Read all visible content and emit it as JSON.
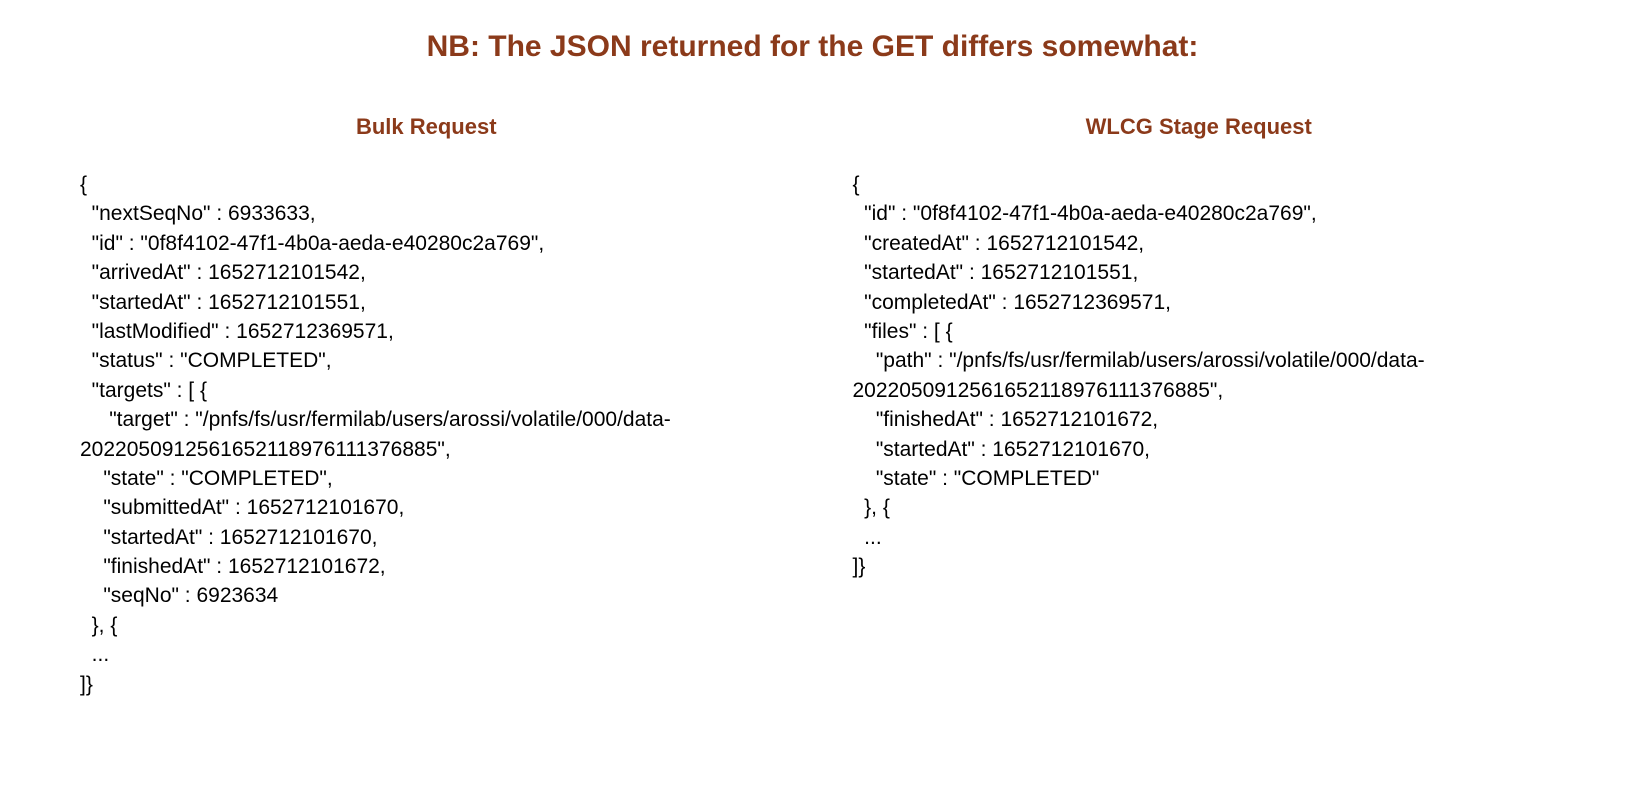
{
  "title": "NB: The JSON returned for the GET differs somewhat:",
  "left": {
    "heading": "Bulk Request",
    "code": "{\n  \"nextSeqNo\" : 6933633,\n  \"id\" : \"0f8f4102-47f1-4b0a-aeda-e40280c2a769\",\n  \"arrivedAt\" : 1652712101542,\n  \"startedAt\" : 1652712101551,\n  \"lastModified\" : 1652712369571,\n  \"status\" : \"COMPLETED\",\n  \"targets\" : [ {\n     \"target\" : \"/pnfs/fs/usr/fermilab/users/arossi/volatile/000/data-2022050912561652118976111376885\",\n    \"state\" : \"COMPLETED\",\n    \"submittedAt\" : 1652712101670,\n    \"startedAt\" : 1652712101670,\n    \"finishedAt\" : 1652712101672,\n    \"seqNo\" : 6923634\n  }, {\n  ...\n]}"
  },
  "right": {
    "heading": "WLCG Stage Request",
    "code": "{\n  \"id\" : \"0f8f4102-47f1-4b0a-aeda-e40280c2a769\",\n  \"createdAt\" : 1652712101542,\n  \"startedAt\" : 1652712101551,\n  \"completedAt\" : 1652712369571,\n  \"files\" : [ {\n    \"path\" : \"/pnfs/fs/usr/fermilab/users/arossi/volatile/000/data-2022050912561652118976111376885\",\n    \"finishedAt\" : 1652712101672,\n    \"startedAt\" : 1652712101670,\n    \"state\" : \"COMPLETED\"\n  }, {\n  ...\n]}"
  }
}
